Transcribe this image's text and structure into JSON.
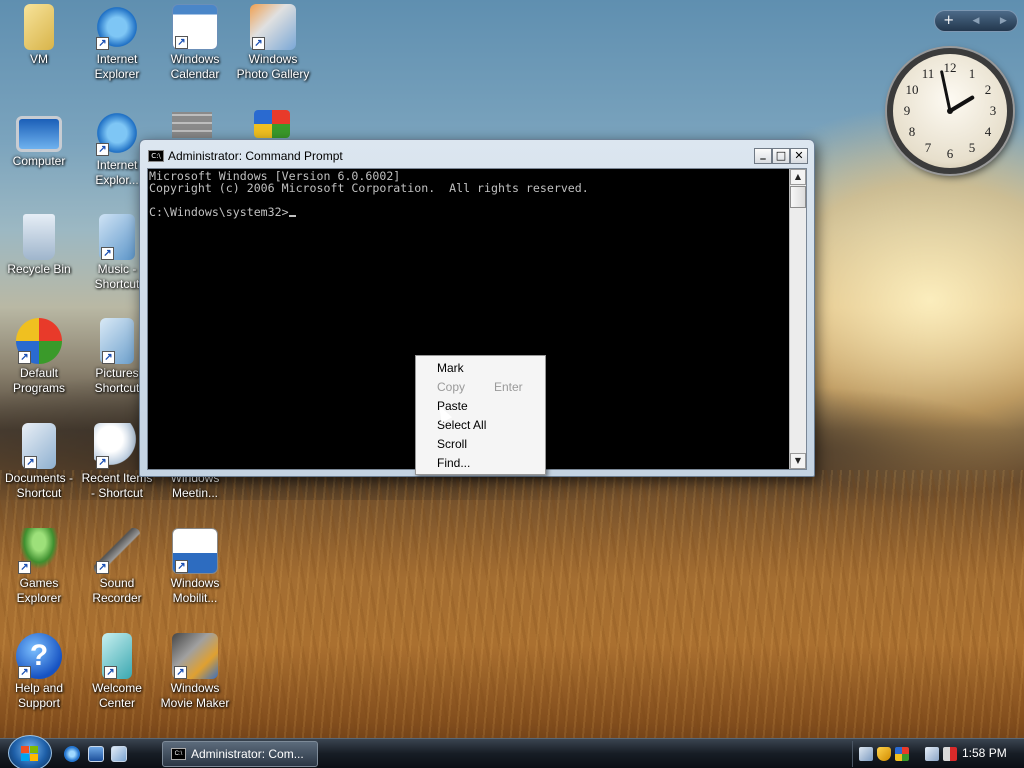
{
  "desktop": {
    "icons": [
      {
        "label": "VM"
      },
      {
        "label": "Internet Explorer"
      },
      {
        "label": "Windows Calendar"
      },
      {
        "label": "Windows Photo Gallery"
      },
      {
        "label": "Computer"
      },
      {
        "label": "Internet Explor..."
      },
      {
        "label": "Recycle Bin"
      },
      {
        "label": "Music - Shortcut"
      },
      {
        "label": "Default Programs"
      },
      {
        "label": "Pictures Shortcut"
      },
      {
        "label": "Documents - Shortcut"
      },
      {
        "label": "Recent Items - Shortcut"
      },
      {
        "label": "Windows Meetin..."
      },
      {
        "label": "Games Explorer"
      },
      {
        "label": "Sound Recorder"
      },
      {
        "label": "Windows Mobilit..."
      },
      {
        "label": "Help and Support"
      },
      {
        "label": "Welcome Center"
      },
      {
        "label": "Windows Movie Maker"
      }
    ]
  },
  "gadgets": {
    "toolbar": {
      "add": "+",
      "prev": "◀",
      "next": "▶"
    },
    "clock": {
      "numbers": [
        "12",
        "1",
        "2",
        "3",
        "4",
        "5",
        "6",
        "7",
        "8",
        "9",
        "10",
        "11"
      ],
      "time": "1:58"
    }
  },
  "cmd_window": {
    "title": "Administrator: Command Prompt",
    "icon_text": "C:\\",
    "buttons": {
      "minimize": "_",
      "maximize": "□",
      "close": "✕"
    },
    "lines": [
      "Microsoft Windows [Version 6.0.6002]",
      "Copyright (c) 2006 Microsoft Corporation.  All rights reserved.",
      "",
      "C:\\Windows\\system32>"
    ]
  },
  "context_menu": {
    "items": [
      {
        "label": "Mark",
        "enabled": true
      },
      {
        "label": "Copy",
        "accel": "Enter",
        "enabled": false
      },
      {
        "label": "Paste",
        "enabled": true
      },
      {
        "label": "Select All",
        "enabled": true
      },
      {
        "label": "Scroll",
        "enabled": true
      },
      {
        "label": "Find...",
        "enabled": true
      }
    ]
  },
  "taskbar": {
    "task_button": "Administrator: Com...",
    "clock": "1:58 PM"
  },
  "icons": {
    "start": "windows-orb-icon",
    "quick_launch": [
      "internet-explorer-icon",
      "show-desktop-icon",
      "switch-windows-icon"
    ],
    "tray": [
      "network-icon",
      "security-shield-icon",
      "windows-update-icon",
      "network-error-icon",
      "volume-muted-icon"
    ]
  }
}
